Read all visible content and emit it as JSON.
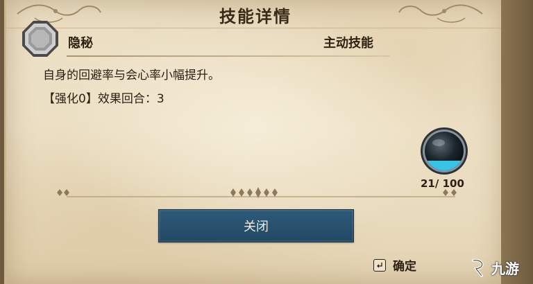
{
  "dialog": {
    "title": "技能详情",
    "close_label": "关闭",
    "confirm_label": "确定"
  },
  "skill": {
    "name": "隐秘",
    "type": "主动技能",
    "description": "自身的回避率与会心率小幅提升。",
    "enhance_line": "【强化0】效果回合：3"
  },
  "energy": {
    "current": 21,
    "max": 100,
    "text": "21/ 100"
  },
  "watermark": {
    "text": "九游"
  },
  "colors": {
    "button": "#2d5a7a",
    "parchment": "#efe4cb",
    "text": "#2a1f12",
    "orb_fill": "#39c3e6"
  }
}
